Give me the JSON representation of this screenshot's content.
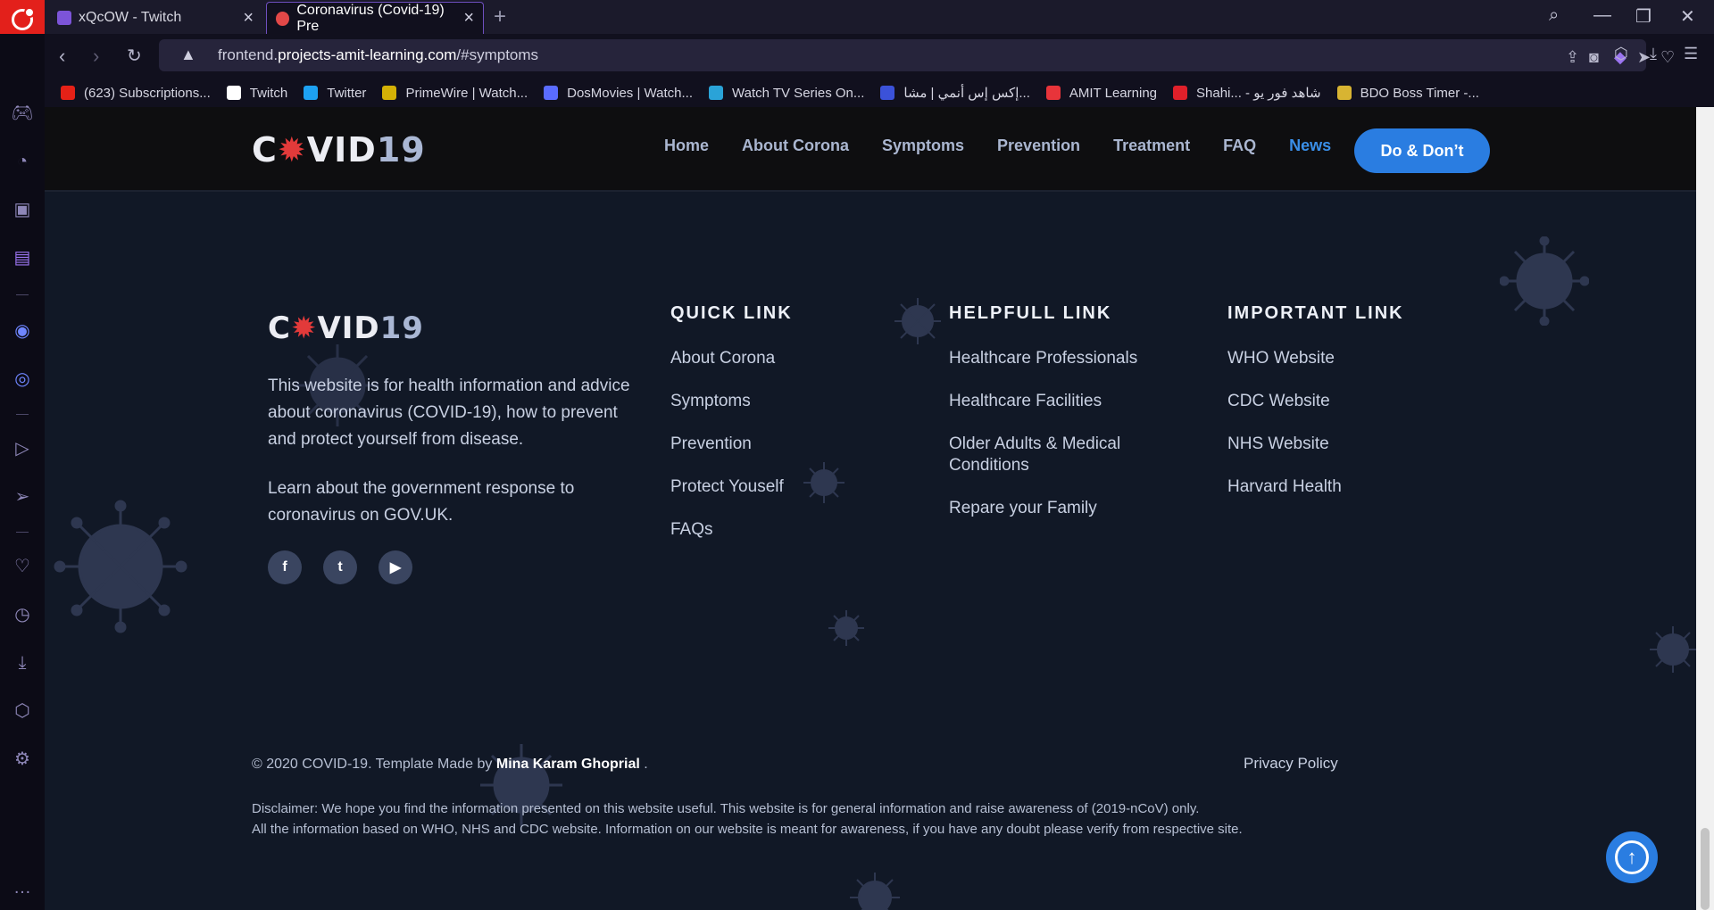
{
  "browser": {
    "tabs": [
      {
        "title": "xQcOW - Twitch"
      },
      {
        "title": "Coronavirus (Covid-19) Pre"
      }
    ],
    "url_prefix": "frontend.",
    "url_domain": "projects-amit-learning.com",
    "url_path": "/#symptoms",
    "bookmarks": [
      {
        "label": "(623) Subscriptions...",
        "color": "#e62117"
      },
      {
        "label": "Twitch",
        "color": "#ffffff"
      },
      {
        "label": "Twitter",
        "color": "#1da1f2"
      },
      {
        "label": "PrimeWire | Watch...",
        "color": "#d4b106"
      },
      {
        "label": "DosMovies | Watch...",
        "color": "#5a6cff"
      },
      {
        "label": "Watch TV Series On...",
        "color": "#2aa3d8"
      },
      {
        "label": "إكس إس أنمي | مشا...",
        "color": "#3b52d9"
      },
      {
        "label": "AMIT Learning",
        "color": "#e8343a"
      },
      {
        "label": "Shahi... - شاهد فور يو",
        "color": "#e0202a"
      },
      {
        "label": "BDO Boss Timer -...",
        "color": "#d8b432"
      }
    ]
  },
  "site": {
    "logo": {
      "prefix": "C",
      "suffix_white": "VID",
      "suffix_color": "19"
    },
    "nav": [
      {
        "label": "Home"
      },
      {
        "label": "About Corona"
      },
      {
        "label": "Symptoms"
      },
      {
        "label": "Prevention"
      },
      {
        "label": "Treatment"
      },
      {
        "label": "FAQ"
      },
      {
        "label": "News"
      }
    ],
    "cta_label": "Do & Don’t"
  },
  "footer": {
    "about_p1": "This website is for health information and advice about coronavirus (COVID-19), how to prevent and protect yourself from disease.",
    "about_p2": "Learn about the government response to coronavirus on GOV.UK.",
    "quick_title": "QUICK LINK",
    "quick_links": [
      "About Corona",
      "Symptoms",
      "Prevention",
      "Protect Youself",
      "FAQs"
    ],
    "helpful_title": "HELPFULL LINK",
    "helpful_links": [
      "Healthcare Professionals",
      "Healthcare Facilities",
      "Older Adults & Medical Conditions",
      "Repare your Family"
    ],
    "important_title": "IMPORTANT LINK",
    "important_links": [
      "WHO Website",
      "CDC Website",
      "NHS Website",
      "Harvard Health"
    ],
    "copyright_text": "© 2020 COVID-19. Template Made by ",
    "author": "Mina Karam Ghoprial",
    "copyright_end": " .",
    "privacy": "Privacy Policy",
    "disclaimer_1": "Disclaimer: We hope you find the information presented on this website useful. This website is for general information and raise awareness of (2019-nCoV) only.",
    "disclaimer_2": "All the information based on WHO, NHS and CDC website. Information on our website is meant for awareness, if you have any doubt please verify from respective site."
  }
}
